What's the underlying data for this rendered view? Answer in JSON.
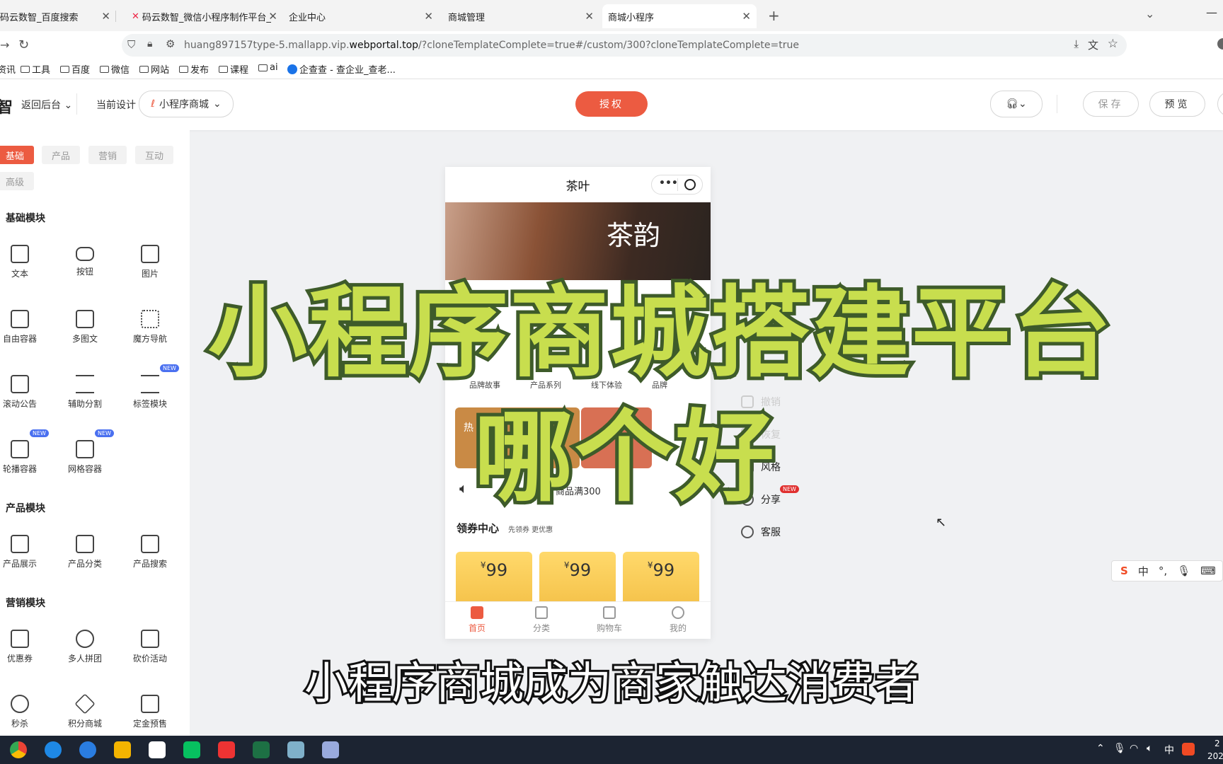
{
  "browser": {
    "tabs": [
      {
        "label": "码云数智_百度搜索"
      },
      {
        "label": "码云数智_微信小程序制作平台_"
      },
      {
        "label": "企业中心"
      },
      {
        "label": "商城管理"
      },
      {
        "label": "商城小程序"
      }
    ],
    "address": {
      "prefix": "huang897157type-5.mallapp.vip.",
      "domain": "webportal.top",
      "suffix": "/?cloneTemplateComplete=true#/custom/300?cloneTemplateComplete=true"
    },
    "bookmarks": [
      "资讯",
      "工具",
      "百度",
      "微信",
      "网站",
      "发布",
      "课程",
      "ai",
      "企查查 - 查企业_查老..."
    ]
  },
  "header": {
    "logo_char": "智",
    "back_label": "返回后台",
    "current_design_label": "当前设计",
    "design_select": "小程序商城",
    "auth_label": "授权",
    "save_label": "保存",
    "preview_label": "预览"
  },
  "sidebar": {
    "tabs": [
      "基础",
      "产品",
      "营销",
      "互动",
      "高级"
    ],
    "sections": [
      {
        "title": "基础模块",
        "items": [
          "文本",
          "按钮",
          "图片",
          "自由容器",
          "多图文",
          "魔方导航",
          "滚动公告",
          "辅助分割",
          "标签模块",
          "轮播容器",
          "网格容器"
        ]
      },
      {
        "title": "产品模块",
        "items": [
          "产品展示",
          "产品分类",
          "产品搜索"
        ]
      },
      {
        "title": "营销模块",
        "items": [
          "优惠券",
          "多人拼团",
          "砍价活动",
          "秒杀",
          "积分商城",
          "定金预售"
        ]
      }
    ],
    "new_badge": "NEW"
  },
  "phone": {
    "title": "茶叶",
    "banner_text": "茶韵",
    "nav": [
      "品牌故事",
      "产品系列",
      "线下体验",
      "品牌"
    ],
    "hot_label": "热",
    "notice": "商品满300",
    "coupon_title": "领券中心",
    "coupon_sub": "先领券 更优惠",
    "coupons": [
      {
        "currency": "¥",
        "value": "99"
      },
      {
        "currency": "¥",
        "value": "99"
      },
      {
        "currency": "¥",
        "value": "99"
      }
    ],
    "tabbar": [
      "首页",
      "分类",
      "购物车",
      "我的"
    ]
  },
  "tools": {
    "undo": "撤销",
    "redo": "恢复",
    "style": "风格",
    "share": "分享",
    "service": "客服",
    "new_badge": "NEW"
  },
  "overlay": {
    "line1": "小程序商城搭建平台",
    "line2": "哪个好",
    "subtitle": "小程序商城成为商家触达消费者"
  },
  "ime": {
    "lang": "中"
  },
  "taskbar": {
    "time": "2",
    "date": "202",
    "lang": "中"
  },
  "colors": {
    "accent": "#ec5b41",
    "overlay_fill": "#c8de4e",
    "overlay_stroke": "#3e5b2a"
  }
}
